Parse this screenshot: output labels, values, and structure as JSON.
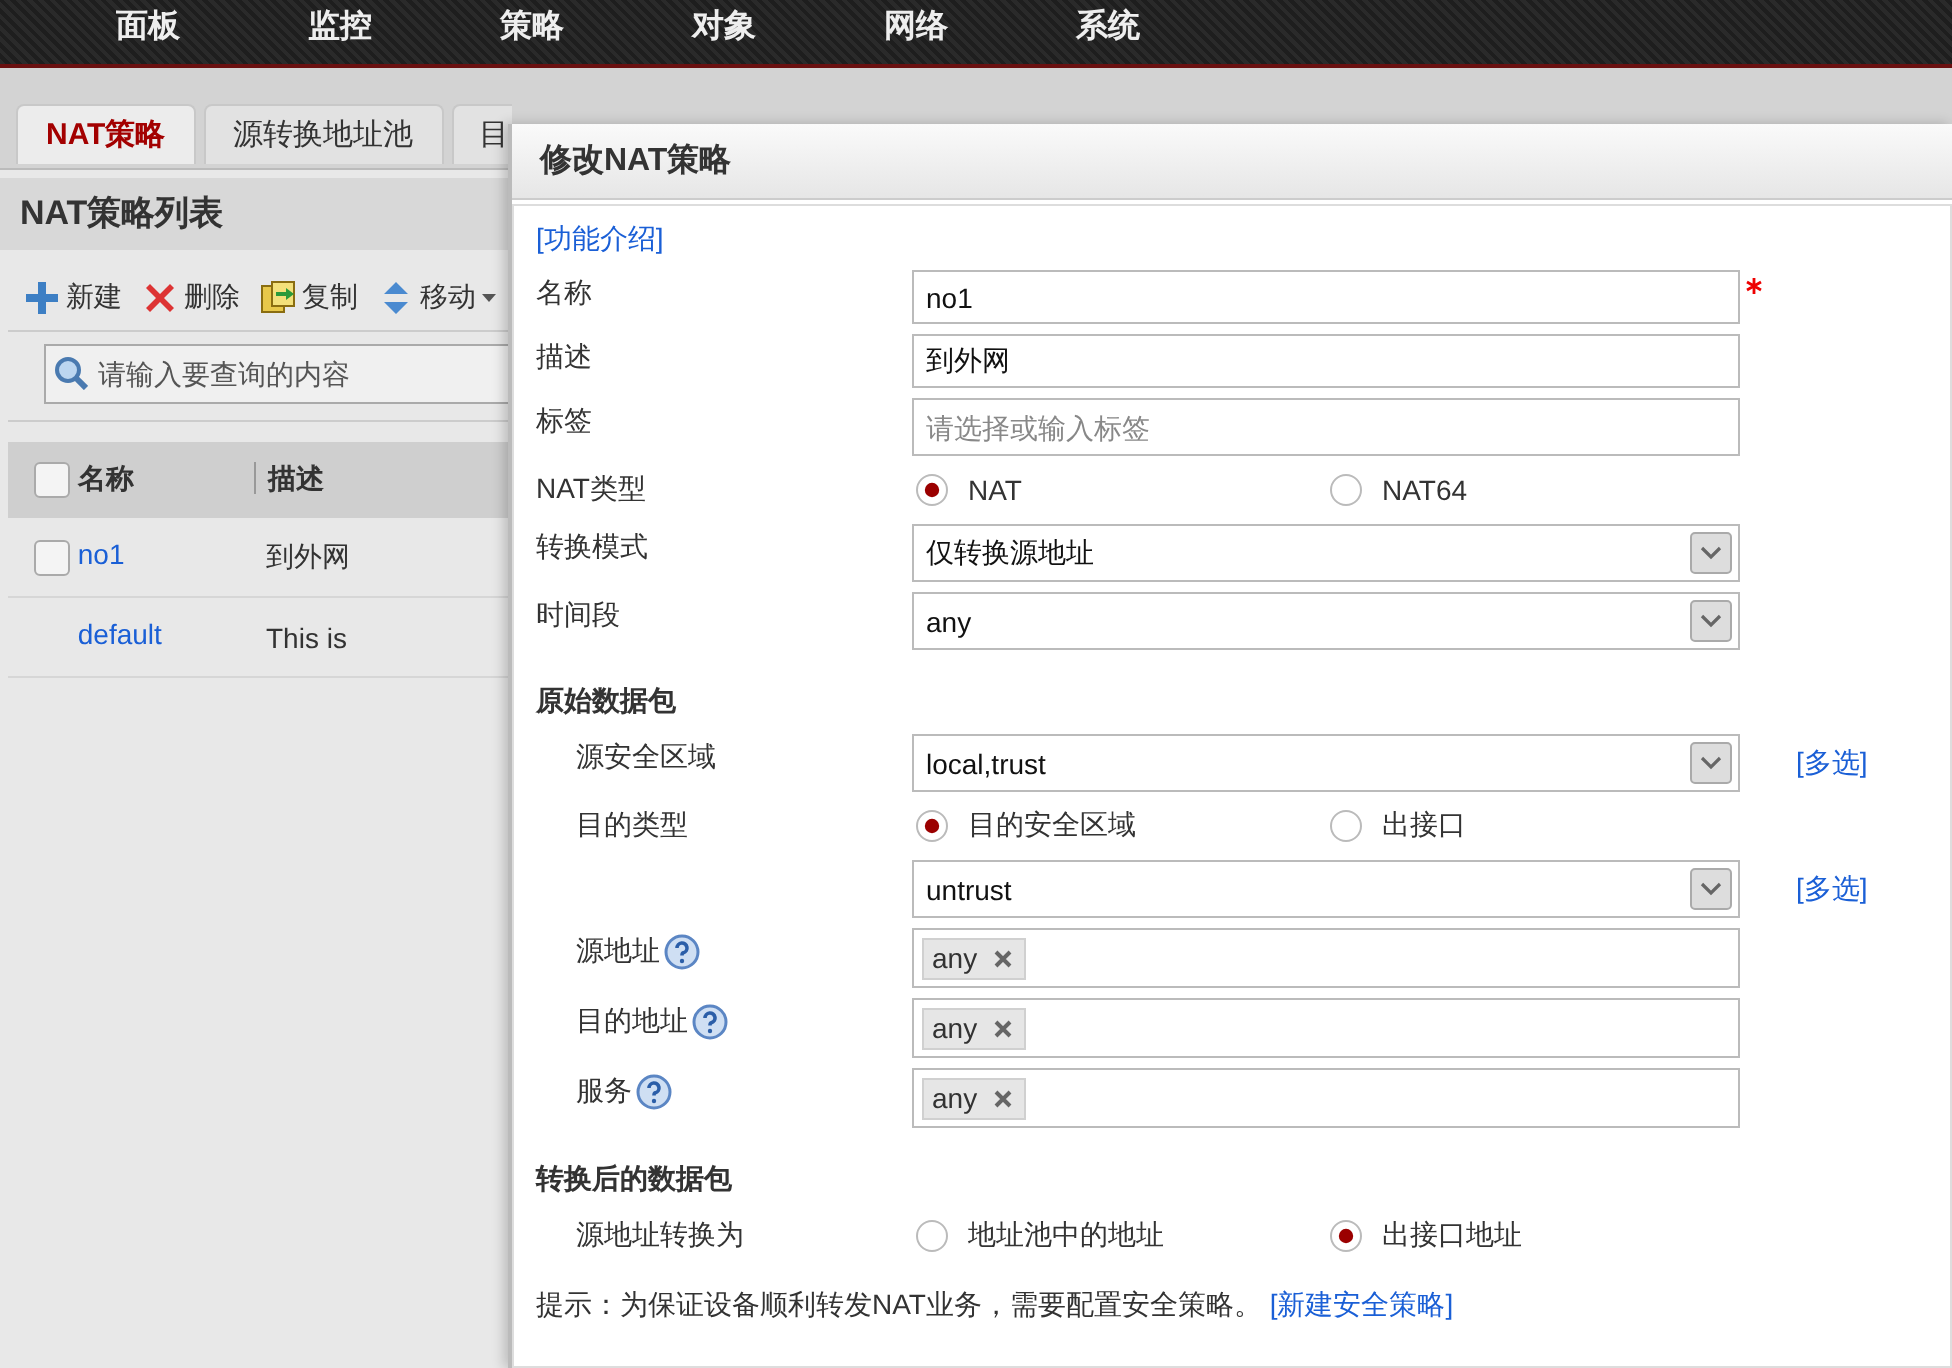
{
  "nav": {
    "items": [
      {
        "label": "面板"
      },
      {
        "label": "监控"
      },
      {
        "label": "策略"
      },
      {
        "label": "对象"
      },
      {
        "label": "网络"
      },
      {
        "label": "系统"
      }
    ]
  },
  "tabs": [
    {
      "label": "NAT策略",
      "selected": true
    },
    {
      "label": "源转换地址池",
      "selected": false
    },
    {
      "label": "目",
      "selected": false
    }
  ],
  "list_panel": {
    "title": "NAT策略列表",
    "toolbar": [
      {
        "label": "新建",
        "kind": "add"
      },
      {
        "label": "删除",
        "kind": "delete"
      },
      {
        "label": "复制",
        "kind": "copy"
      },
      {
        "label": "移动",
        "kind": "move"
      }
    ],
    "search": {
      "placeholder": "请输入要查询的内容"
    },
    "table": {
      "columns": [
        "名称",
        "描述"
      ],
      "all_checked": false,
      "rows": [
        {
          "name": "no1",
          "description": "到外网",
          "checkbox": true,
          "checked": false
        },
        {
          "name": "default",
          "description": "This is",
          "checkbox": false,
          "checked": false
        }
      ]
    }
  },
  "dialog": {
    "title": "修改NAT策略",
    "help_link": "[功能介绍]",
    "fields": [
      {
        "kind": "text",
        "label": "名称",
        "value": "no1",
        "required": true
      },
      {
        "kind": "text",
        "label": "描述",
        "value": "到外网",
        "required": false
      },
      {
        "kind": "text",
        "label": "标签",
        "placeholder": "请选择或输入标签",
        "required": false
      },
      {
        "kind": "radio",
        "label": "NAT类型",
        "options": [
          {
            "label": "NAT",
            "selected": true
          },
          {
            "label": "NAT64",
            "selected": false
          }
        ]
      },
      {
        "kind": "select",
        "label": "转换模式",
        "value": "仅转换源地址"
      },
      {
        "kind": "select",
        "label": "时间段",
        "value": "any"
      }
    ],
    "sections": [
      {
        "title": "原始数据包",
        "fields": [
          {
            "kind": "select",
            "label": "源安全区域",
            "value": "local,trust",
            "link": "[多选]"
          },
          {
            "kind": "radio",
            "label": "目的类型",
            "options": [
              {
                "label": "目的安全区域",
                "selected": true
              },
              {
                "label": "出接口",
                "selected": false
              }
            ]
          },
          {
            "kind": "select",
            "value": "untrust",
            "link": "[多选]"
          },
          {
            "kind": "tags",
            "label": "源地址",
            "help": true,
            "tags": [
              "any"
            ]
          },
          {
            "kind": "tags",
            "label": "目的地址",
            "help": true,
            "tags": [
              "any"
            ]
          },
          {
            "kind": "tags",
            "label": "服务",
            "help": true,
            "tags": [
              "any"
            ]
          }
        ]
      },
      {
        "title": "转换后的数据包",
        "fields": [
          {
            "kind": "radio",
            "label": "源地址转换为",
            "options": [
              {
                "label": "地址池中的地址",
                "selected": false
              },
              {
                "label": "出接口地址",
                "selected": true
              }
            ]
          }
        ]
      }
    ],
    "note": {
      "text": "提示：为保证设备顺利转发NAT业务，需要配置安全策略。",
      "link": "[新建安全策略]"
    }
  }
}
